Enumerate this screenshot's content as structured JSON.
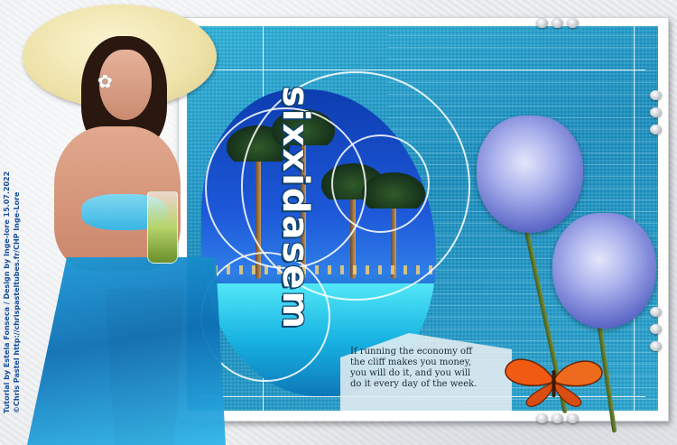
{
  "title_word": "sixxidasem",
  "quote_text": "If running the economy off the cliff makes you money, you will do it, and you will do it every day of the week.",
  "credits": {
    "line1": "Tutorial by Estela Fonseca / Design by Inge-lore 15.07.2022",
    "line2": "©Chris Pastel  http://chrispasteltubes.fr/CHP  Inge-Lore"
  },
  "colors": {
    "panel_blue": "#1a8fc0",
    "skirt_blue": "#1b9ad8",
    "rose_blue": "#5c67c7",
    "butterfly_orange": "#f05a12",
    "frame_white": "#ffffff"
  },
  "icons": {
    "flower": "white-flower-icon",
    "butterfly": "butterfly-icon"
  }
}
